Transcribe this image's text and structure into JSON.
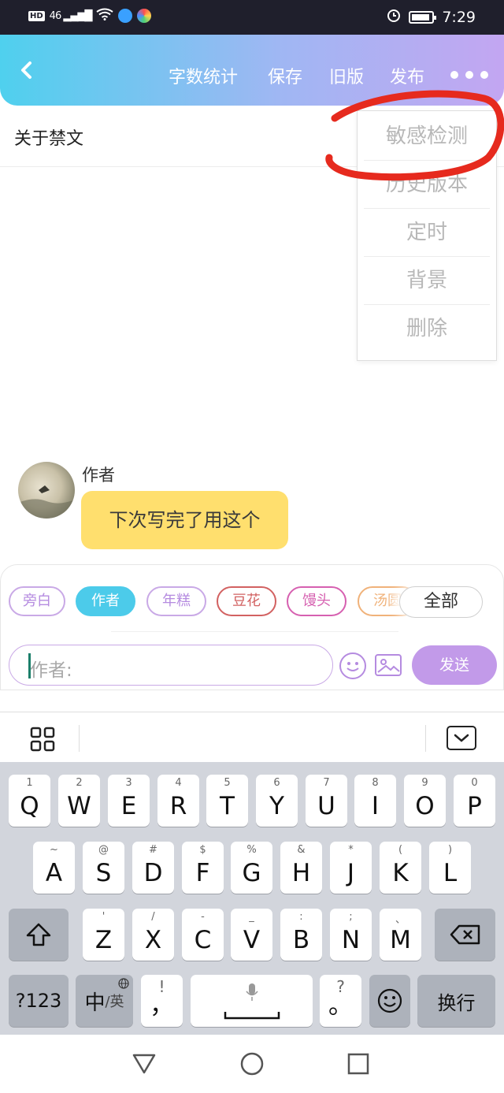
{
  "status_bar": {
    "network_badge": "HD",
    "signal_label": "46",
    "time": "7:29"
  },
  "header": {
    "back_icon": "chevron-left-icon",
    "actions": [
      "字数统计",
      "保存",
      "旧版",
      "发布"
    ],
    "more_icon": "more-dots-icon"
  },
  "document": {
    "title": "关于禁文"
  },
  "dropdown_menu": {
    "items": [
      "敏感检测",
      "历史版本",
      "定时",
      "背景",
      "删除"
    ]
  },
  "chat": {
    "sender_name": "作者",
    "message": "下次写完了用这个"
  },
  "composer": {
    "chips": [
      {
        "label": "旁白",
        "color": "#c9a9e6",
        "text_color": "#b58be0"
      },
      {
        "label": "作者",
        "color": "#4ccbea",
        "text_color": "#ffffff",
        "selected": true
      },
      {
        "label": "年糕",
        "color": "#c9a9e6",
        "text_color": "#b58be0"
      },
      {
        "label": "豆花",
        "color": "#d26161",
        "text_color": "#d26161"
      },
      {
        "label": "馒头",
        "color": "#d660b0",
        "text_color": "#d660b0"
      },
      {
        "label": "汤圆",
        "color": "#f0b27a",
        "text_color": "#f0b27a"
      }
    ],
    "all_chip_label": "全部",
    "input_placeholder": "作者:",
    "send_label": "发送"
  },
  "keyboard": {
    "row1": [
      {
        "main": "Q",
        "sub": "1"
      },
      {
        "main": "W",
        "sub": "2"
      },
      {
        "main": "E",
        "sub": "3"
      },
      {
        "main": "R",
        "sub": "4"
      },
      {
        "main": "T",
        "sub": "5"
      },
      {
        "main": "Y",
        "sub": "6"
      },
      {
        "main": "U",
        "sub": "7"
      },
      {
        "main": "I",
        "sub": "8"
      },
      {
        "main": "O",
        "sub": "9"
      },
      {
        "main": "P",
        "sub": "0"
      }
    ],
    "row2": [
      {
        "main": "A",
        "sub": "~"
      },
      {
        "main": "S",
        "sub": "@"
      },
      {
        "main": "D",
        "sub": "#"
      },
      {
        "main": "F",
        "sub": "$"
      },
      {
        "main": "G",
        "sub": "%"
      },
      {
        "main": "H",
        "sub": "&"
      },
      {
        "main": "J",
        "sub": "*"
      },
      {
        "main": "K",
        "sub": "("
      },
      {
        "main": "L",
        "sub": ")"
      }
    ],
    "row3": [
      {
        "main": "Z",
        "sub": "'"
      },
      {
        "main": "X",
        "sub": "/"
      },
      {
        "main": "C",
        "sub": "-"
      },
      {
        "main": "V",
        "sub": "_"
      },
      {
        "main": "B",
        "sub": ":"
      },
      {
        "main": "N",
        "sub": ";"
      },
      {
        "main": "M",
        "sub": "、"
      }
    ],
    "symbols_key": "?123",
    "lang_key_main": "中",
    "lang_key_sub": "/英",
    "comma_key_main": "，",
    "comma_key_sub": "!",
    "period_key_main": "。",
    "period_key_sub": "?",
    "enter_key": "换行"
  }
}
